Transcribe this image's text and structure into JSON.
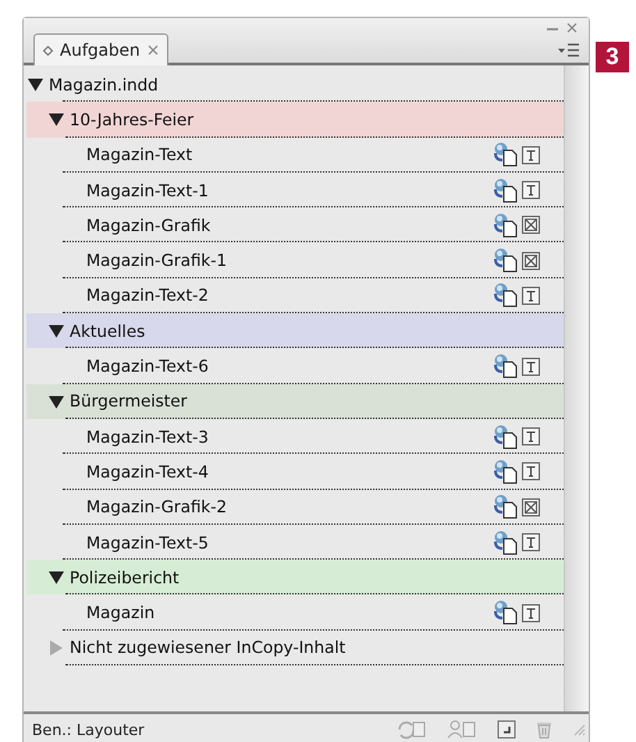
{
  "panel": {
    "tab": "Aufgaben",
    "user_label": "Ben.: Layouter"
  },
  "badge": "3",
  "tree": {
    "label": "Magazin.indd",
    "expanded": true,
    "children": [
      {
        "label": "10-Jahres-Feier",
        "expanded": true,
        "color": "#f1d5d5",
        "children": [
          {
            "label": "Magazin-Text",
            "kind": "text"
          },
          {
            "label": "Magazin-Text-1",
            "kind": "text"
          },
          {
            "label": "Magazin-Grafik",
            "kind": "graphic"
          },
          {
            "label": "Magazin-Grafik-1",
            "kind": "graphic"
          },
          {
            "label": "Magazin-Text-2",
            "kind": "text"
          }
        ]
      },
      {
        "label": "Aktuelles",
        "expanded": true,
        "color": "#d8d8ec",
        "children": [
          {
            "label": "Magazin-Text-6",
            "kind": "text"
          }
        ]
      },
      {
        "label": "Bürgermeister",
        "expanded": true,
        "color": "#d9e1d7",
        "children": [
          {
            "label": "Magazin-Text-3",
            "kind": "text"
          },
          {
            "label": "Magazin-Text-4",
            "kind": "text"
          },
          {
            "label": "Magazin-Grafik-2",
            "kind": "graphic"
          },
          {
            "label": "Magazin-Text-5",
            "kind": "text"
          }
        ]
      },
      {
        "label": "Polizeibericht",
        "expanded": true,
        "color": "#d7ecd5",
        "children": [
          {
            "label": "Magazin",
            "kind": "text"
          }
        ]
      },
      {
        "label": "Nicht zugewiesener InCopy-Inhalt",
        "expanded": false
      }
    ]
  }
}
